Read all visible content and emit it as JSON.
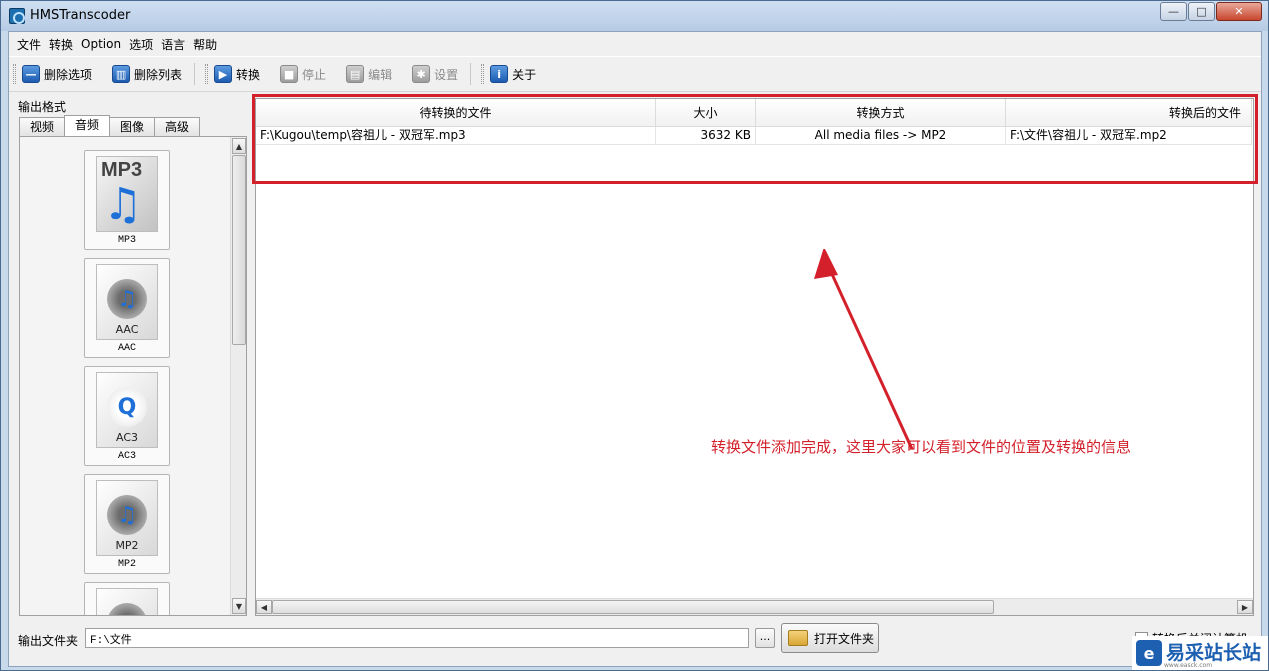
{
  "window": {
    "title": "HMSTranscoder",
    "controls": {
      "minimize": "—",
      "maximize": "□",
      "close": "✕"
    }
  },
  "menu": [
    "文件",
    "转换",
    "Option",
    "选项",
    "语言",
    "帮助"
  ],
  "toolbar": {
    "delete_item": "删除选项",
    "delete_list": "删除列表",
    "convert": "转换",
    "stop": "停止",
    "edit": "编辑",
    "settings": "设置",
    "about": "关于"
  },
  "left_panel": {
    "label": "输出格式",
    "tabs": [
      "视频",
      "音频",
      "图像",
      "高级"
    ],
    "active_tab": "音频",
    "formats": [
      {
        "name": "MP3",
        "art_label": "MP3"
      },
      {
        "name": "AAC",
        "art_label": "AAC"
      },
      {
        "name": "AC3",
        "art_label": "AC3"
      },
      {
        "name": "MP2",
        "art_label": "MP2"
      }
    ]
  },
  "file_table": {
    "columns": [
      "待转换的文件",
      "大小",
      "转换方式",
      "转换后的文件"
    ],
    "rows": [
      {
        "source": "F:\\Kugou\\temp\\容祖儿 - 双冠军.mp3",
        "size": "3632 KB",
        "mode": "All media files -> MP2",
        "target": "F:\\文件\\容祖儿 - 双冠军.mp2"
      }
    ]
  },
  "annotation": "转换文件添加完成，这里大家可以看到文件的位置及转换的信息",
  "bottom": {
    "output_label": "输出文件夹",
    "output_path": "F:\\文件",
    "browse": "...",
    "open_folder": "打开文件夹",
    "shutdown_label": "转换后关闭计算机"
  },
  "watermark": {
    "logo": "e",
    "text": "易采站长站",
    "sub": "www.easck.com"
  },
  "colors": {
    "highlight": "#d3202a",
    "accent_blue": "#1d5fb0"
  }
}
